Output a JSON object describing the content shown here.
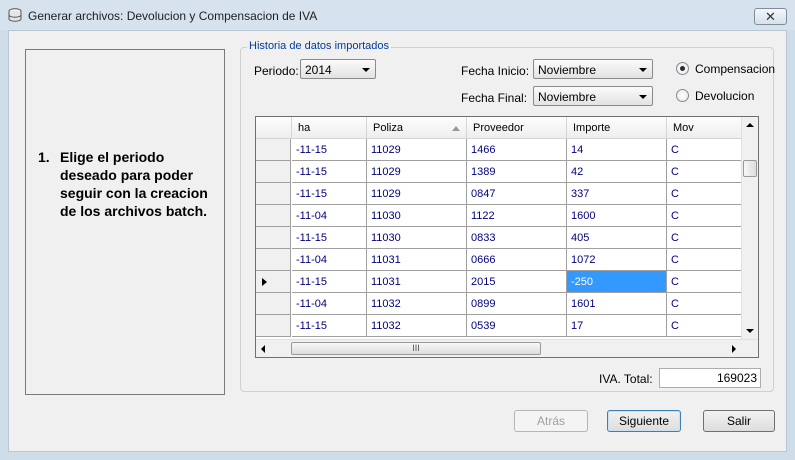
{
  "window": {
    "title": "Generar archivos: Devolucion y Compensacion de IVA",
    "close_glyph": "✕",
    "icon": "database-icon"
  },
  "instructions": {
    "number": "1.",
    "text": "Elige el periodo deseado para poder seguir con la creacion de los archivos batch."
  },
  "group": {
    "title": "Historia de datos importados",
    "periodo_label": "Periodo:",
    "periodo_value": "2014",
    "fecha_inicio_label": "Fecha Inicio:",
    "fecha_inicio_value": "Noviembre",
    "fecha_final_label": "Fecha Final:",
    "fecha_final_value": "Noviembre",
    "radio_compensacion": "Compensacion",
    "radio_devolucion": "Devolucion",
    "selected_radio": "Compensacion"
  },
  "table": {
    "columns": [
      "ha",
      "Poliza",
      "Proveedor",
      "Importe",
      "Mov"
    ],
    "rows": [
      [
        "-11-15",
        "11029",
        "1466",
        "14",
        "C"
      ],
      [
        "-11-15",
        "11029",
        "1389",
        "42",
        "C"
      ],
      [
        "-11-15",
        "11029",
        "0847",
        "337",
        "C"
      ],
      [
        "-11-04",
        "11030",
        "1122",
        "1600",
        "C"
      ],
      [
        "-11-15",
        "11030",
        "0833",
        "405",
        "C"
      ],
      [
        "-11-04",
        "11031",
        "0666",
        "1072",
        "C"
      ],
      [
        "-11-15",
        "11031",
        "2015",
        "-250",
        "C"
      ],
      [
        "-11-04",
        "11032",
        "0899",
        "1601",
        "C"
      ],
      [
        "-11-15",
        "11032",
        "0539",
        "17",
        "C"
      ]
    ],
    "current_row": 6,
    "selected_cell": "Importe",
    "scroll_thumb_label": "III"
  },
  "total": {
    "label": "IVA. Total:",
    "value": "169023"
  },
  "buttons": {
    "back": "Atrás",
    "next": "Siguiente",
    "exit": "Salir"
  },
  "colors": {
    "selection": "#3399ff",
    "cell_text": "#000080",
    "group_title": "#003c9e"
  }
}
